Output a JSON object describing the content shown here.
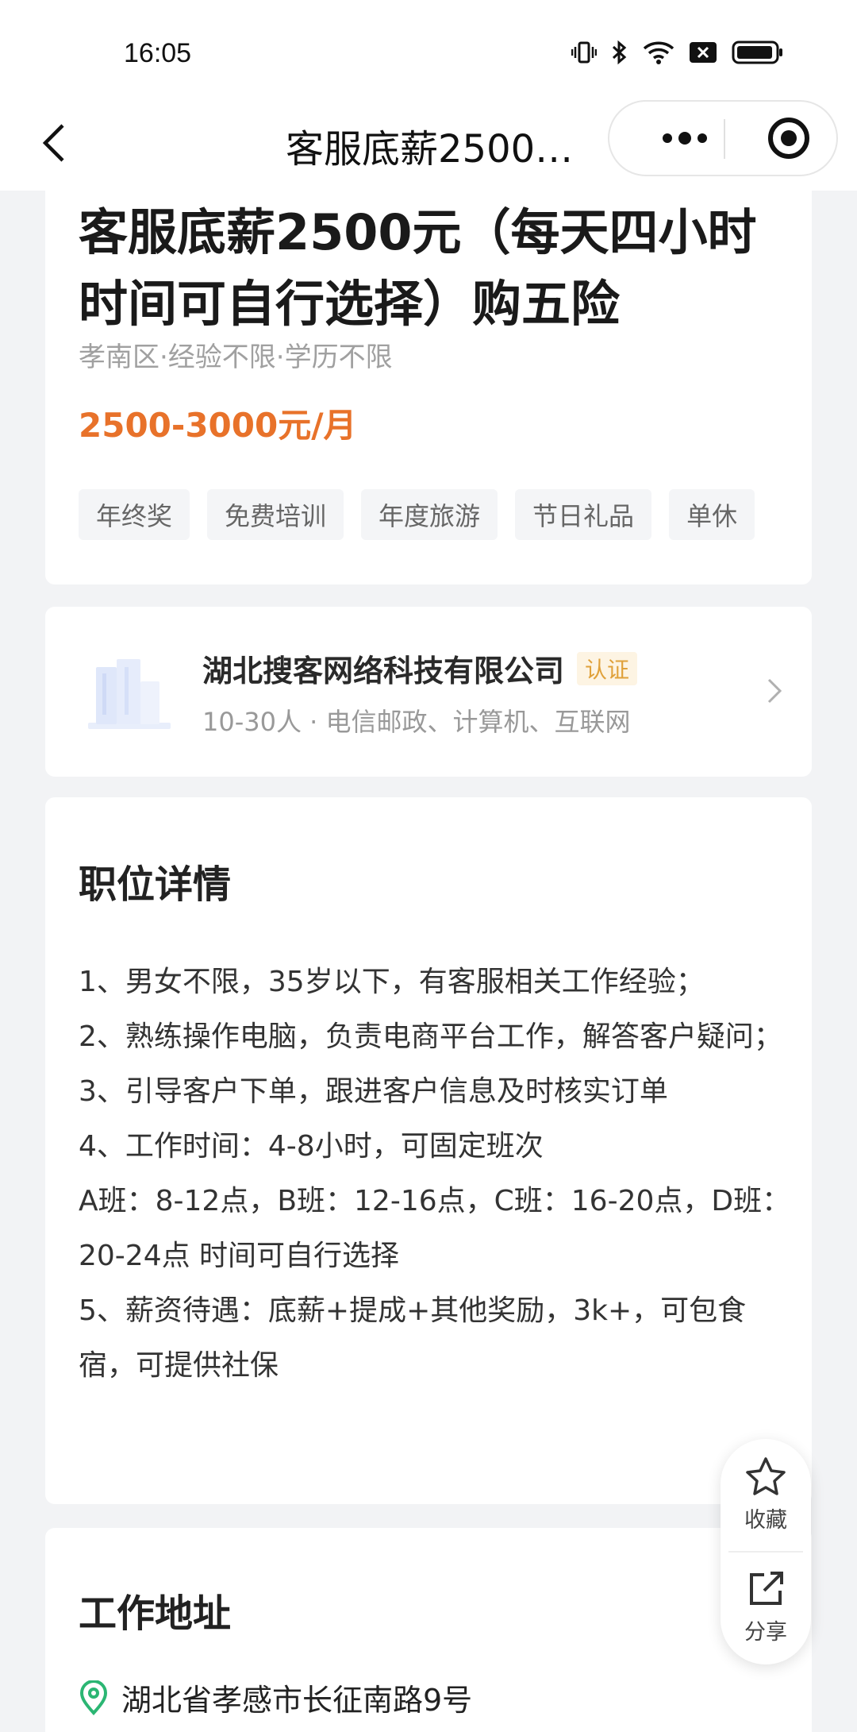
{
  "status_bar": {
    "time": "16:05"
  },
  "nav": {
    "title": "客服底薪2500…"
  },
  "job": {
    "title": "客服底薪2500元（每天四小时时间可自行选择）购五险",
    "meta": "孝南区·经验不限·学历不限",
    "salary": "2500-3000元/月",
    "tags": [
      "年终奖",
      "免费培训",
      "年度旅游",
      "节日礼品",
      "单休"
    ]
  },
  "company": {
    "name": "湖北搜客网络科技有限公司",
    "badge": "认证",
    "info": "10-30人 · 电信邮政、计算机、互联网"
  },
  "detail": {
    "heading": "职位详情",
    "lines": [
      "1、男女不限，35岁以下，有客服相关工作经验；",
      "2、熟练操作电脑，负责电商平台工作，解答客户疑问；",
      "3、引导客户下单，跟进客户信息及时核实订单",
      "4、工作时间：4-8小时，可固定班次",
      "A班：8-12点，B班：12-16点，C班：16-20点，D班：20-24点  时间可自行选择",
      "5、薪资待遇：底薪+提成+其他奖励，3k+，可包食宿，可提供社保"
    ]
  },
  "address": {
    "heading": "工作地址",
    "text": "湖北省孝感市长征南路9号"
  },
  "actions": {
    "favorite": "收藏",
    "share": "分享"
  },
  "colors": {
    "salary": "#e8722a",
    "badge_text": "#e0a13a",
    "location_icon": "#2bb673"
  }
}
